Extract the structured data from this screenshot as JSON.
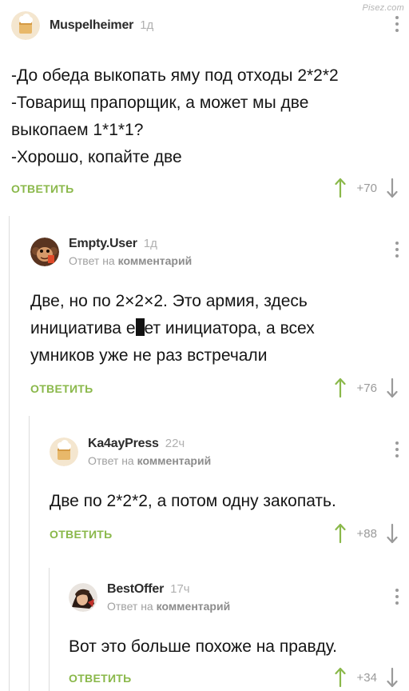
{
  "watermark": "Pisez.com",
  "reply_prefix": "Ответ на",
  "reply_target": "комментарий",
  "comments": [
    {
      "author": "Muspelheimer",
      "time": "1д",
      "lines": [
        "-До обеда выкопать яму под отходы 2*2*2",
        "-Товарищ прапорщик, а может мы две",
        "выкопаем 1*1*1?",
        "-Хорошо, копайте две"
      ],
      "reply_label": "ОТВЕТИТЬ",
      "rating": "+70"
    },
    {
      "author": "Empty.User",
      "time": "1д",
      "lines": [
        "Две, но по 2×2×2. Это армия, здесь",
        "инициатива е",
        "ет инициатора, а всех",
        "умников уже не раз встречали"
      ],
      "reply_label": "ОТВЕТИТЬ",
      "rating": "+76"
    },
    {
      "author": "Ka4ayPress",
      "time": "22ч",
      "lines": [
        "Две по 2*2*2, а потом одну закопать."
      ],
      "reply_label": "ОТВЕТИТЬ",
      "rating": "+88"
    },
    {
      "author": "BestOffer",
      "time": "17ч",
      "lines": [
        "Вот это больше похоже на правду."
      ],
      "reply_label": "ОТВЕТИТЬ",
      "rating": "+34"
    }
  ],
  "colors": {
    "accent": "#8ab84a",
    "muted": "#9a9a9a",
    "thread": "#dcdcdc"
  },
  "icons": {
    "upvote": "arrow-up-icon",
    "downvote": "arrow-down-icon",
    "more": "more-vertical-icon"
  }
}
